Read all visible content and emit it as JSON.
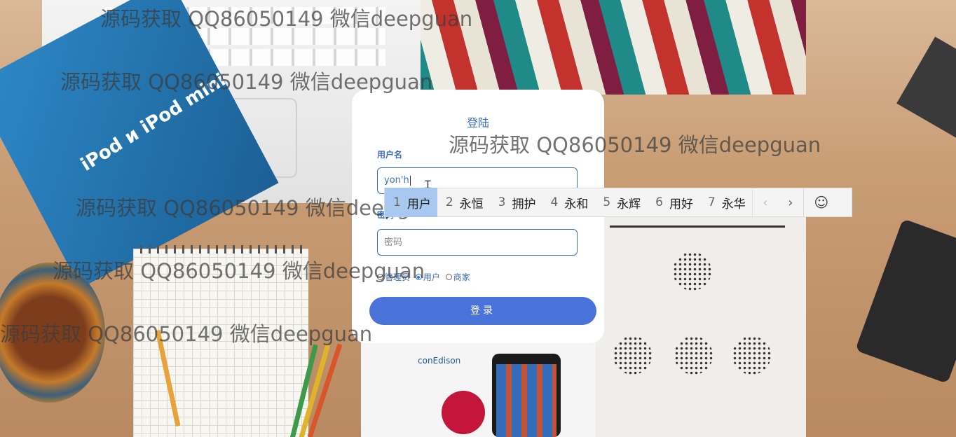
{
  "watermarks": [
    "源码获取 QQ86050149 微信deepguan",
    "源码获取 QQ86050149 微信deepguan",
    "源码获取 QQ86050149 微信deepguan",
    "源码获取 QQ86050149 微信deepguan",
    "源码获取 QQ86050149 微信deepguan",
    "源码获取 QQ86050149 微信deepguan"
  ],
  "background": {
    "book_title": "iPod и iPod mini",
    "flyer_brand": "conEdison"
  },
  "login": {
    "title": "登陆",
    "username_label": "用户名",
    "username_value": "yon'h",
    "password_label": "密码",
    "password_placeholder": "密码",
    "roles": [
      {
        "label": "管理员",
        "checked": false
      },
      {
        "label": "用户",
        "checked": true
      },
      {
        "label": "商家",
        "checked": false
      }
    ],
    "submit_label": "登录"
  },
  "ime": {
    "candidates": [
      {
        "num": "1",
        "text": "用户",
        "selected": true
      },
      {
        "num": "2",
        "text": "永恒",
        "selected": false
      },
      {
        "num": "3",
        "text": "拥护",
        "selected": false
      },
      {
        "num": "4",
        "text": "永和",
        "selected": false
      },
      {
        "num": "5",
        "text": "永辉",
        "selected": false
      },
      {
        "num": "6",
        "text": "用好",
        "selected": false
      },
      {
        "num": "7",
        "text": "永华",
        "selected": false
      }
    ],
    "prev_icon": "‹",
    "next_icon": "›",
    "emoji_icon": "☺"
  },
  "colors": {
    "accent": "#3c6dbd",
    "button": "#4a73d9",
    "ime_selected": "#a9c8ef"
  }
}
